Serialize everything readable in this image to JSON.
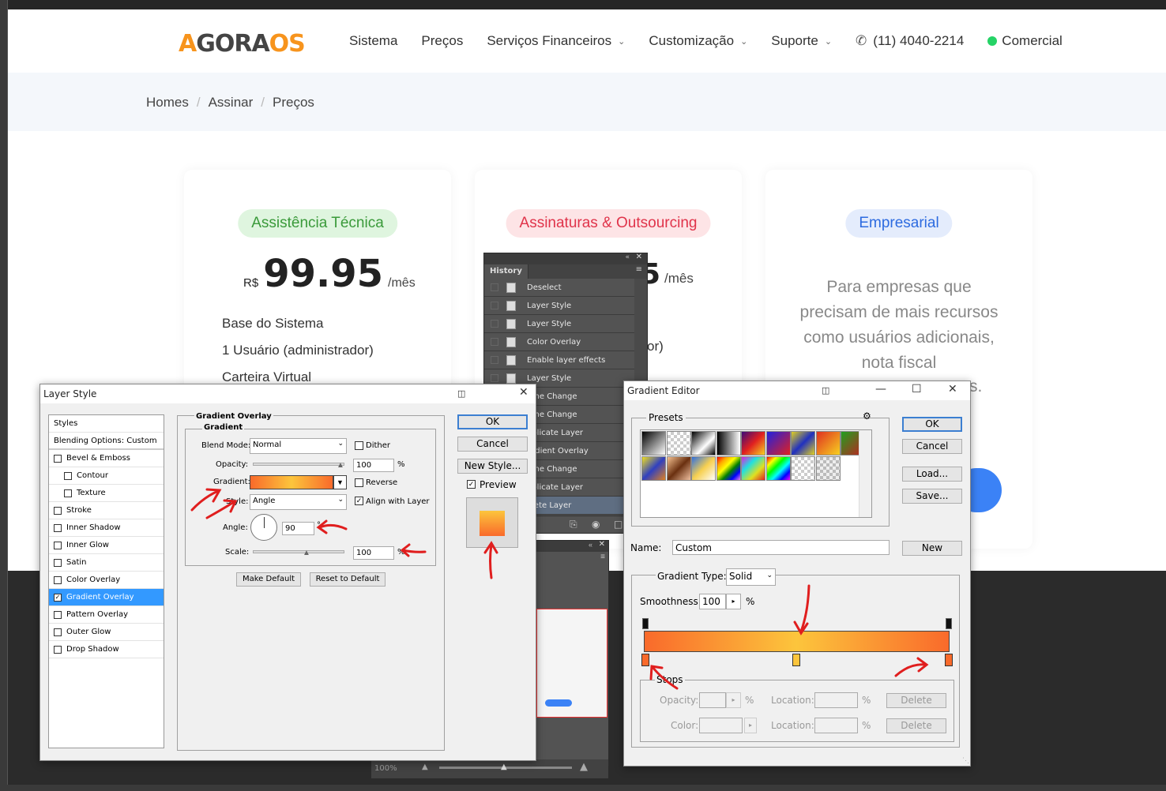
{
  "site": {
    "logo": {
      "a": "A",
      "gora": "GORA",
      "os": "OS"
    },
    "nav": [
      {
        "label": "Sistema",
        "dropdown": false
      },
      {
        "label": "Preços",
        "dropdown": false
      },
      {
        "label": "Serviços Financeiros",
        "dropdown": true
      },
      {
        "label": "Customização",
        "dropdown": true
      },
      {
        "label": "Suporte",
        "dropdown": true
      }
    ],
    "phone": "(11) 4040-2214",
    "comercial": "Comercial",
    "breadcrumbs": [
      "Homes",
      "Assinar",
      "Preços"
    ],
    "cards": [
      {
        "badge": "Assistência Técnica",
        "currency": "R$",
        "price": "99.95",
        "period": "/mês",
        "features": [
          "Base do Sistema",
          "1 Usuário (administrador)",
          "Carteira Virtual"
        ]
      },
      {
        "badge": "Assinaturas & Outsourcing",
        "price_tail": "5",
        "period": "/mês",
        "feature_tail": "or)"
      },
      {
        "badge": "Empresarial",
        "description": "Para empresas que precisam de mais recursos como usuários adicionais, nota fiscal",
        "desc_tail": "s."
      }
    ],
    "colors": {
      "accent": "#f7941d",
      "green": "#3a9a3a",
      "red": "#e0334a",
      "blue": "#2d6be0"
    }
  },
  "history": {
    "tab": "History",
    "items": [
      "Deselect",
      "Layer Style",
      "Layer Style",
      "Color Overlay",
      "Enable layer effects",
      "Layer Style",
      "ame Change",
      "ame Change",
      "uplicate Layer",
      "radient Overlay",
      "ame Change",
      "uplicate Layer",
      "elete Layer"
    ]
  },
  "status": {
    "zoom": "100%"
  },
  "layer_style": {
    "title": "Layer Style",
    "styles_header": "Styles",
    "blending": "Blending Options: Custom",
    "effects": [
      {
        "label": "Bevel & Emboss",
        "checked": false,
        "indent": false
      },
      {
        "label": "Contour",
        "checked": false,
        "indent": true
      },
      {
        "label": "Texture",
        "checked": false,
        "indent": true
      },
      {
        "label": "Stroke",
        "checked": false,
        "indent": false
      },
      {
        "label": "Inner Shadow",
        "checked": false,
        "indent": false
      },
      {
        "label": "Inner Glow",
        "checked": false,
        "indent": false
      },
      {
        "label": "Satin",
        "checked": false,
        "indent": false
      },
      {
        "label": "Color Overlay",
        "checked": false,
        "indent": false
      },
      {
        "label": "Gradient Overlay",
        "checked": true,
        "indent": false,
        "selected": true
      },
      {
        "label": "Pattern Overlay",
        "checked": false,
        "indent": false
      },
      {
        "label": "Outer Glow",
        "checked": false,
        "indent": false
      },
      {
        "label": "Drop Shadow",
        "checked": false,
        "indent": false
      }
    ],
    "section_title": "Gradient Overlay",
    "subsection": "Gradient",
    "blend_mode_label": "Blend Mode:",
    "blend_mode": "Normal",
    "dither": "Dither",
    "opacity_label": "Opacity:",
    "opacity": "100",
    "pct": "%",
    "gradient_label": "Gradient:",
    "reverse": "Reverse",
    "style_label": "Style:",
    "style": "Angle",
    "align": "Align with Layer",
    "angle_label": "Angle:",
    "angle": "90",
    "angle_unit": "°",
    "scale_label": "Scale:",
    "scale": "100",
    "make_default": "Make Default",
    "reset_default": "Reset to Default",
    "ok": "OK",
    "cancel": "Cancel",
    "new_style": "New Style...",
    "preview": "Preview"
  },
  "gradient_editor": {
    "title": "Gradient Editor",
    "presets": "Presets",
    "ok": "OK",
    "cancel": "Cancel",
    "load": "Load...",
    "save": "Save...",
    "name_label": "Name:",
    "name": "Custom",
    "new": "New",
    "type_label": "Gradient Type:",
    "type": "Solid",
    "smooth_label": "Smoothness:",
    "smoothness": "100",
    "pct": "%",
    "stops": "Stops",
    "opacity_label": "Opacity:",
    "color_label": "Color:",
    "location_label": "Location:",
    "delete": "Delete"
  }
}
